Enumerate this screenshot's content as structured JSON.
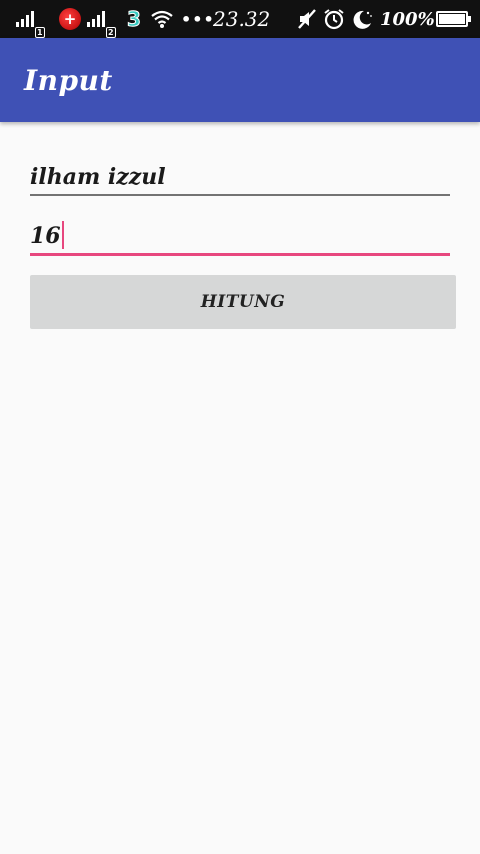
{
  "status_bar": {
    "sim1_badge": "1",
    "sim2_badge": "2",
    "carrier_glyph": "+",
    "carrier3_glyph": "3",
    "more_glyph": "•••",
    "time": "23.32",
    "battery_percent": "100%",
    "icons": [
      "signal-icon",
      "sim1-badge",
      "carrier-logo-icon",
      "signal-icon",
      "sim2-badge",
      "three-carrier-icon",
      "wifi-icon",
      "more-icon",
      "mute-icon",
      "alarm-icon",
      "night-mode-icon",
      "battery-icon"
    ],
    "color": "#111111"
  },
  "app_bar": {
    "title": "Input",
    "color": "#3f51b5"
  },
  "form": {
    "name_value": "ilham izzul",
    "age_value": "16",
    "focus_color": "#e7477e",
    "button_label": "HITUNG",
    "button_color": "#d6d7d7"
  }
}
